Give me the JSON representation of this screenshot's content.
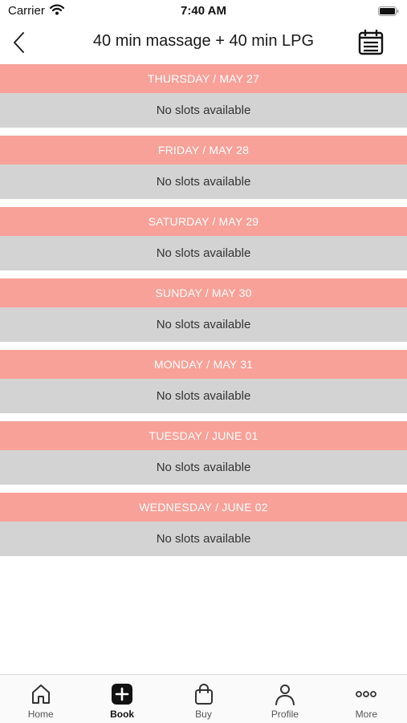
{
  "status_bar": {
    "carrier": "Carrier",
    "time": "7:40 AM"
  },
  "nav": {
    "title": "40 min massage + 40 min LPG",
    "back_icon": "chevron-left-icon",
    "calendar_icon": "calendar-icon"
  },
  "colors": {
    "header_bg": "#f8a198",
    "slot_bg": "#d3d3d3"
  },
  "days": [
    {
      "label": "THURSDAY / MAY 27",
      "status": "No slots available"
    },
    {
      "label": "FRIDAY / MAY 28",
      "status": "No slots available"
    },
    {
      "label": "SATURDAY / MAY 29",
      "status": "No slots available"
    },
    {
      "label": "SUNDAY / MAY 30",
      "status": "No slots available"
    },
    {
      "label": "MONDAY / MAY 31",
      "status": "No slots available"
    },
    {
      "label": "TUESDAY / JUNE 01",
      "status": "No slots available"
    },
    {
      "label": "WEDNESDAY / JUNE 02",
      "status": "No slots available"
    }
  ],
  "tabs": [
    {
      "label": "Home",
      "icon": "home-icon",
      "active": false
    },
    {
      "label": "Book",
      "icon": "plus-square-icon",
      "active": true
    },
    {
      "label": "Buy",
      "icon": "shopping-bag-icon",
      "active": false
    },
    {
      "label": "Profile",
      "icon": "person-icon",
      "active": false
    },
    {
      "label": "More",
      "icon": "more-dots-icon",
      "active": false
    }
  ]
}
